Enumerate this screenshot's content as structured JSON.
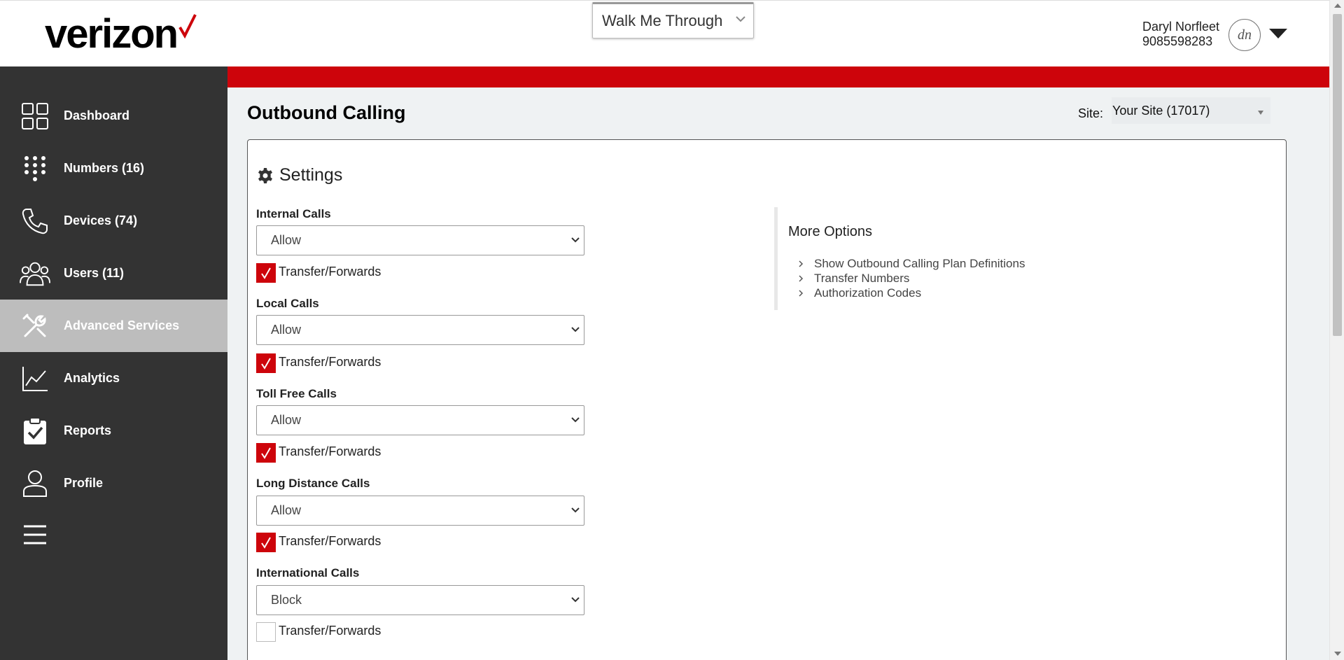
{
  "brand": {
    "logo_text": "verizon",
    "accent_color": "#cd040b",
    "sidebar_color": "#333333"
  },
  "header": {
    "walk_me": "Walk Me Through",
    "user_name": "Daryl Norfleet",
    "user_phone": "9085598283",
    "avatar_initials": "dn"
  },
  "sidebar": {
    "items": [
      {
        "label": "Dashboard",
        "icon": "dashboard-grid-icon"
      },
      {
        "label": "Numbers (16)",
        "icon": "keypad-icon"
      },
      {
        "label": "Devices (74)",
        "icon": "phone-icon"
      },
      {
        "label": "Users (11)",
        "icon": "users-icon"
      },
      {
        "label": "Advanced Services",
        "icon": "tools-icon",
        "active": true
      },
      {
        "label": "Analytics",
        "icon": "chart-line-icon"
      },
      {
        "label": "Reports",
        "icon": "clipboard-check-icon"
      },
      {
        "label": "Profile",
        "icon": "profile-icon"
      }
    ],
    "menu_icon": "hamburger-menu-icon"
  },
  "page": {
    "title": "Outbound Calling",
    "site_label": "Site:",
    "site_value": "Your Site (17017)"
  },
  "settings": {
    "heading": "Settings",
    "fields": [
      {
        "label": "Internal Calls",
        "value": "Allow",
        "transfer_label": "Transfer/Forwards",
        "transfer_checked": true
      },
      {
        "label": "Local Calls",
        "value": "Allow",
        "transfer_label": "Transfer/Forwards",
        "transfer_checked": true
      },
      {
        "label": "Toll Free Calls",
        "value": "Allow",
        "transfer_label": "Transfer/Forwards",
        "transfer_checked": true
      },
      {
        "label": "Long Distance Calls",
        "value": "Allow",
        "transfer_label": "Transfer/Forwards",
        "transfer_checked": true
      },
      {
        "label": "International Calls",
        "value": "Block",
        "transfer_label": "Transfer/Forwards",
        "transfer_checked": false
      }
    ]
  },
  "more_options": {
    "title": "More Options",
    "links": [
      "Show Outbound Calling Plan Definitions",
      "Transfer Numbers",
      "Authorization Codes"
    ]
  }
}
